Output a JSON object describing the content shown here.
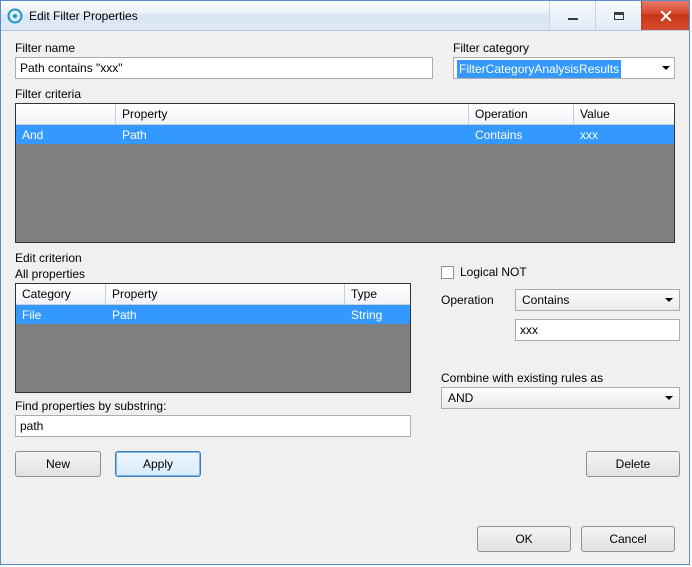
{
  "window": {
    "title": "Edit Filter Properties"
  },
  "filter_name": {
    "label": "Filter name",
    "value": "Path contains \"xxx\""
  },
  "filter_category": {
    "label": "Filter category",
    "selected": "FilterCategoryAnalysisResults"
  },
  "criteria": {
    "label": "Filter criteria",
    "columns": {
      "c0": "",
      "c1": "Property",
      "c2": "Operation",
      "c3": "Value"
    },
    "rows": [
      {
        "c0": "And",
        "c1": "Path",
        "c2": "Contains",
        "c3": "xxx"
      }
    ]
  },
  "edit_criterion": {
    "label": "Edit criterion",
    "all_properties": {
      "label": "All properties",
      "columns": {
        "c0": "Category",
        "c1": "Property",
        "c2": "Type"
      },
      "rows": [
        {
          "c0": "File",
          "c1": "Path",
          "c2": "String"
        }
      ]
    },
    "find_label": "Find properties by substring:",
    "find_value": "path"
  },
  "logical_not": {
    "label": "Logical NOT",
    "checked": false
  },
  "operation": {
    "label": "Operation",
    "selected": "Contains"
  },
  "value_input": {
    "value": "xxx"
  },
  "combine": {
    "label": "Combine with existing rules as",
    "selected": "AND"
  },
  "buttons": {
    "new": "New",
    "apply": "Apply",
    "delete": "Delete",
    "ok": "OK",
    "cancel": "Cancel"
  }
}
